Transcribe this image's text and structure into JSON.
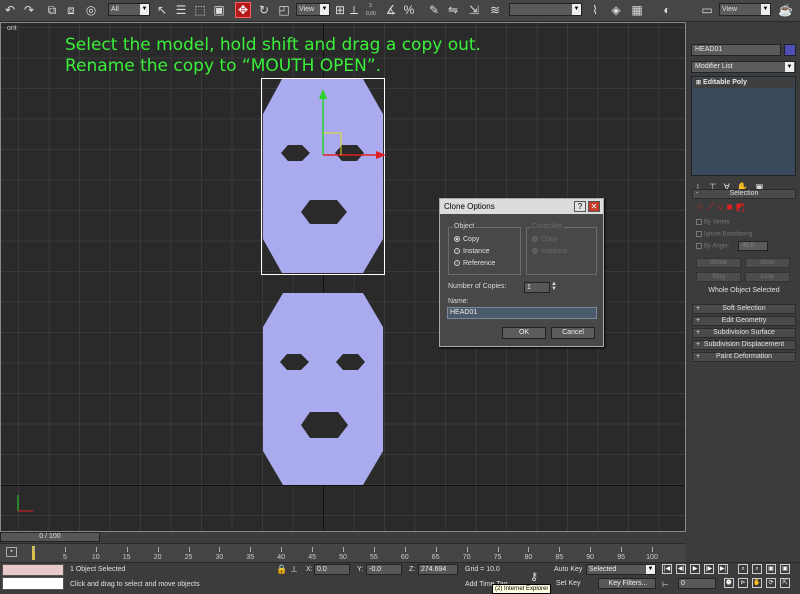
{
  "toolbar": {
    "filter_label": "All",
    "refcoord_label": "View",
    "snap_labels": [
      "3",
      "2.5",
      "%",
      "0,00"
    ],
    "selection_set_value": "",
    "colors": {
      "active_tool": "#b41a1a"
    },
    "icons": [
      "undo-icon",
      "redo-icon",
      "link-icon",
      "unlink-icon",
      "bind-spacewarp-icon",
      "select-filter-icon",
      "select-object-icon",
      "select-by-name-icon",
      "region-select-icon",
      "window-crossing-icon",
      "select-and-move-icon",
      "select-and-rotate-icon",
      "select-and-scale-icon",
      "pivot-icon",
      "mirror-icon",
      "align-icon",
      "layer-manager-icon",
      "curve-editor-icon",
      "schematic-icon",
      "material-editor-icon",
      "render-setup-icon",
      "render-frame-icon",
      "quick-render-icon"
    ],
    "right_select_value": "View"
  },
  "viewport": {
    "label": "ont",
    "instruction_line1": "Select the model, hold shift and drag a copy out.",
    "instruction_line2": "Rename the copy to “MOUTH OPEN”.",
    "mask_color": "#aaaaee"
  },
  "command_panel": {
    "object_name": "HEAD01",
    "object_color": "#4e4eb8",
    "modifier_list": "Modifier List",
    "stack_item": "Editable Poly",
    "selection_rollout": "Selection",
    "by_vertex": "By Vertex",
    "ignore_backfacing": "Ignore Backfacing",
    "by_angle": "By Angle:",
    "by_angle_value": "45.0",
    "shrink": "Shrink",
    "grow": "Grow",
    "ring": "Ring",
    "loop": "Loop",
    "selection_status": "Whole Object Selected",
    "rollouts": [
      "Soft Selection",
      "Edit Geometry",
      "Subdivision Surface",
      "Subdivision Displacement",
      "Paint Deformation"
    ]
  },
  "dialog": {
    "title": "Clone Options",
    "help_btn": "?",
    "close_btn": "✕",
    "object_group": "Object",
    "copy": "Copy",
    "instance": "Instance",
    "reference": "Reference",
    "controller_group": "Controller",
    "ctrl_copy": "Copy",
    "ctrl_instance": "Instance",
    "copies_label": "Number of Copies:",
    "copies_value": "1",
    "name_label": "Name:",
    "name_value": "HEAD01",
    "ok": "OK",
    "cancel": "Cancel"
  },
  "timeline": {
    "frame_display": "0 / 100",
    "ticks": [
      0,
      5,
      10,
      15,
      20,
      25,
      30,
      35,
      40,
      45,
      50,
      55,
      60,
      65,
      70,
      75,
      80,
      85,
      90,
      95,
      100
    ]
  },
  "status": {
    "selected": "1 Object Selected",
    "prompt": "Click and drag to select and move objects",
    "x_label": "X:",
    "x_value": "0.0",
    "y_label": "Y:",
    "y_value": "-0.0",
    "z_label": "Z:",
    "z_value": "274.694",
    "grid": "Grid = 10.0",
    "add_time_tag": "Add Time Tag",
    "auto_key": "Auto Key",
    "set_key": "Set Key",
    "selected_dropdown": "Selected",
    "key_filters": "Key Filters...",
    "current_frame": "0",
    "tooltip": "(2) Internet Explorer"
  }
}
